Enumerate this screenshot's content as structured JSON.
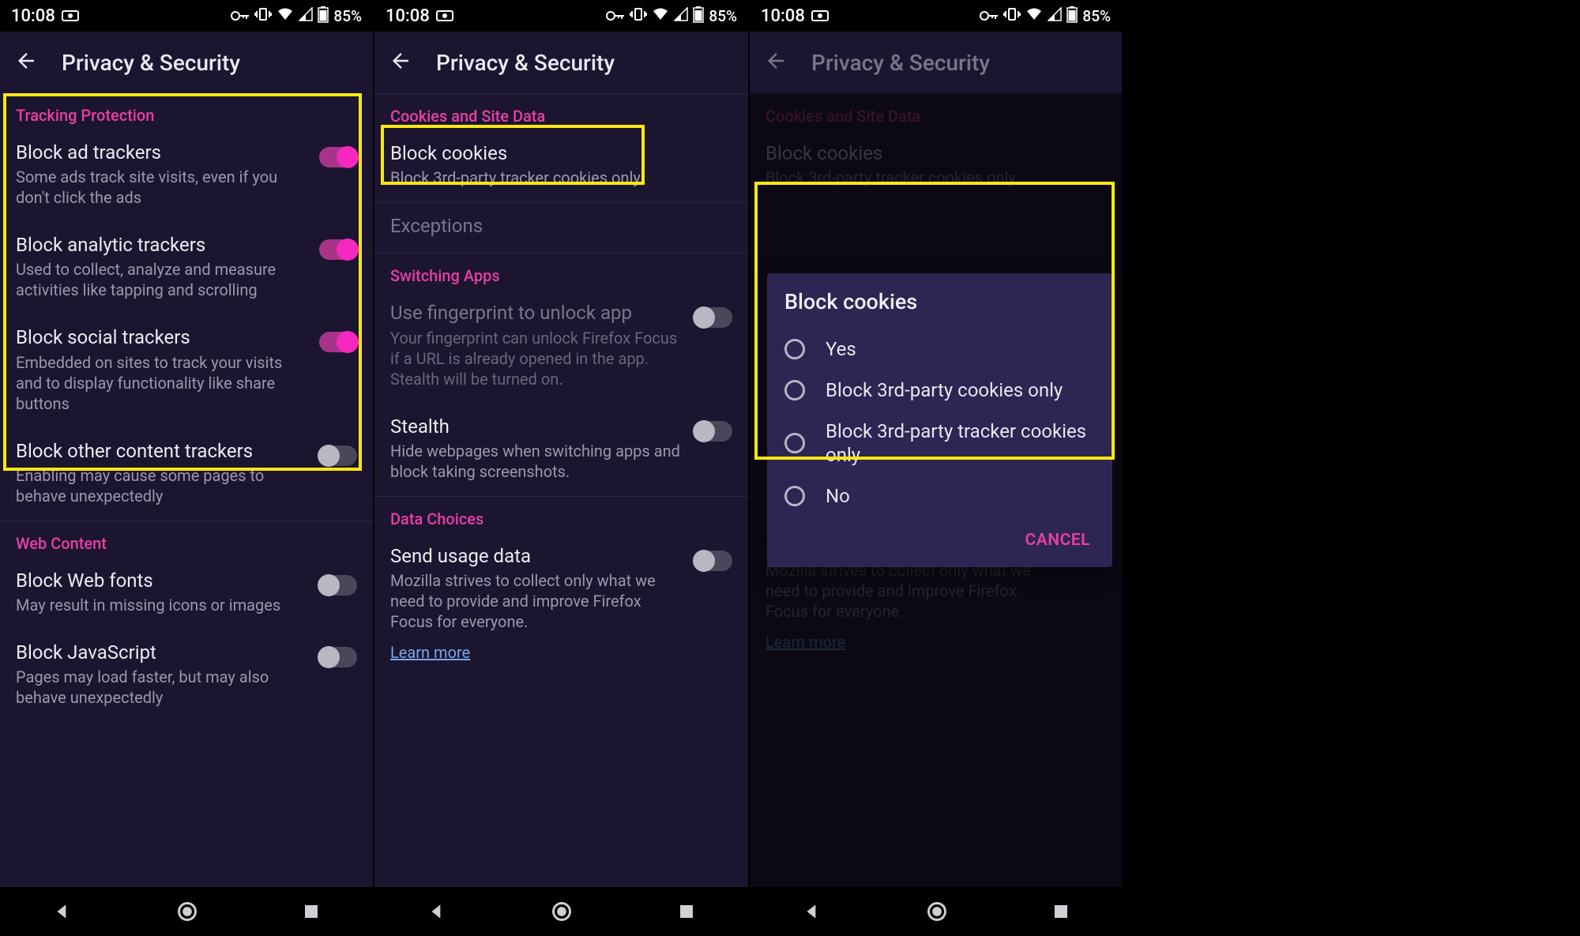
{
  "status": {
    "time": "10:08",
    "battery": "85%"
  },
  "appbar": {
    "title": "Privacy & Security"
  },
  "s1": {
    "sectionA": "Tracking Protection",
    "items": [
      {
        "t": "Block ad trackers",
        "s": "Some ads track site visits, even if you don't click the ads",
        "on": true
      },
      {
        "t": "Block analytic trackers",
        "s": "Used to collect, analyze and measure activities like tapping and scrolling",
        "on": true
      },
      {
        "t": "Block social trackers",
        "s": "Embedded on sites to track your visits and to display functionality like share buttons",
        "on": true
      },
      {
        "t": "Block other content trackers",
        "s": "Enabling may cause some pages to behave unexpectedly",
        "on": false
      }
    ],
    "sectionB": "Web Content",
    "itemsB": [
      {
        "t": "Block Web fonts",
        "s": "May result in missing icons or images",
        "on": false
      },
      {
        "t": "Block JavaScript",
        "s": "Pages may load faster, but may also behave unexpectedly",
        "on": false
      }
    ]
  },
  "s2": {
    "sectionA": "Cookies and Site Data",
    "cookies": {
      "t": "Block cookies",
      "s": "Block 3rd-party tracker cookies only"
    },
    "exceptions": "Exceptions",
    "sectionB": "Switching Apps",
    "fingerprint": {
      "t": "Use fingerprint to unlock app",
      "s": "Your fingerprint can unlock Firefox Focus if a URL is already opened in the app. Stealth will be turned on."
    },
    "stealth": {
      "t": "Stealth",
      "s": "Hide webpages when switching apps and block taking screenshots."
    },
    "sectionC": "Data Choices",
    "usage": {
      "t": "Send usage data",
      "s": "Mozilla strives to collect only what we need to provide and improve Firefox Focus for everyone."
    },
    "learn": "Learn more"
  },
  "s3": {
    "dialog": {
      "title": "Block cookies",
      "options": [
        "Yes",
        "Block 3rd-party cookies only",
        "Block 3rd-party tracker cookies only",
        "No"
      ],
      "cancel": "CANCEL"
    }
  }
}
